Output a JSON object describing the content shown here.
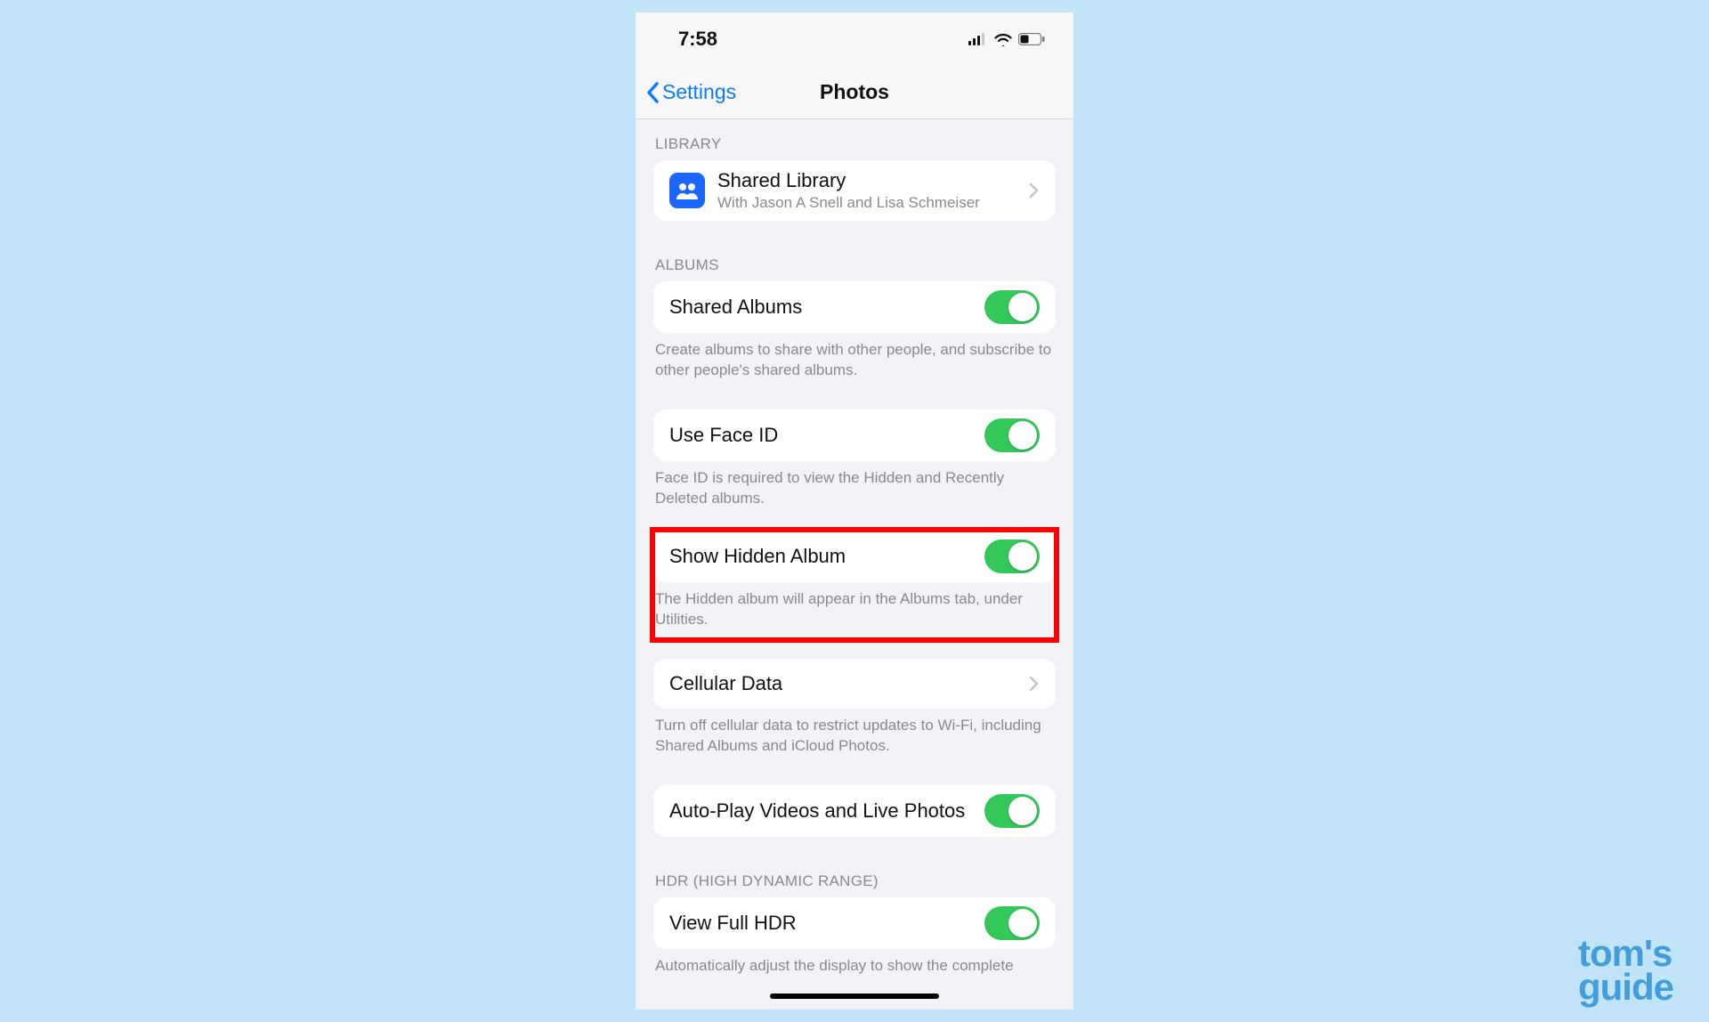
{
  "status": {
    "time": "7:58"
  },
  "nav": {
    "back_label": "Settings",
    "title": "Photos"
  },
  "library": {
    "header": "LIBRARY",
    "shared_library": {
      "title": "Shared Library",
      "subtitle": "With Jason A Snell and Lisa Schmeiser"
    }
  },
  "albums": {
    "header": "ALBUMS",
    "shared_albums": {
      "label": "Shared Albums",
      "on": true
    },
    "shared_albums_footer": "Create albums to share with other people, and subscribe to other people's shared albums.",
    "use_face_id": {
      "label": "Use Face ID",
      "on": true
    },
    "use_face_id_footer": "Face ID is required to view the Hidden and Recently Deleted albums.",
    "show_hidden": {
      "label": "Show Hidden Album",
      "on": true
    },
    "show_hidden_footer": "The Hidden album will appear in the Albums tab, under Utilities.",
    "cellular": {
      "label": "Cellular Data"
    },
    "cellular_footer": "Turn off cellular data to restrict updates to Wi-Fi, including Shared Albums and iCloud Photos.",
    "autoplay": {
      "label": "Auto-Play Videos and Live Photos",
      "on": true
    }
  },
  "hdr": {
    "header": "HDR (HIGH DYNAMIC RANGE)",
    "view_full": {
      "label": "View Full HDR",
      "on": true
    },
    "view_full_footer": "Automatically adjust the display to show the complete"
  },
  "watermark": {
    "line1": "tom's",
    "line2": "guide"
  },
  "colors": {
    "ios_blue": "#0b7bff",
    "toggle_green": "#34c759",
    "highlight_red": "#ff0000"
  }
}
